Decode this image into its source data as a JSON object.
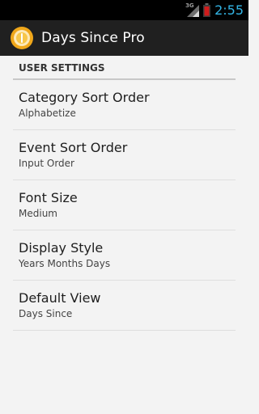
{
  "status_bar": {
    "network_label": "3G",
    "time": "2:55"
  },
  "action_bar": {
    "title": "Days Since Pro",
    "icon": "app-logo-icon"
  },
  "settings": {
    "section_header": "USER SETTINGS",
    "items": [
      {
        "title": "Category Sort Order",
        "summary": "Alphabetize"
      },
      {
        "title": "Event Sort Order",
        "summary": "Input Order"
      },
      {
        "title": "Font Size",
        "summary": "Medium"
      },
      {
        "title": "Display Style",
        "summary": "Years Months Days"
      },
      {
        "title": "Default View",
        "summary": "Days Since"
      }
    ]
  },
  "colors": {
    "clock": "#33b5e5",
    "battery": "#d01c1c",
    "action_bar": "#202020",
    "background": "#f3f3f3"
  }
}
